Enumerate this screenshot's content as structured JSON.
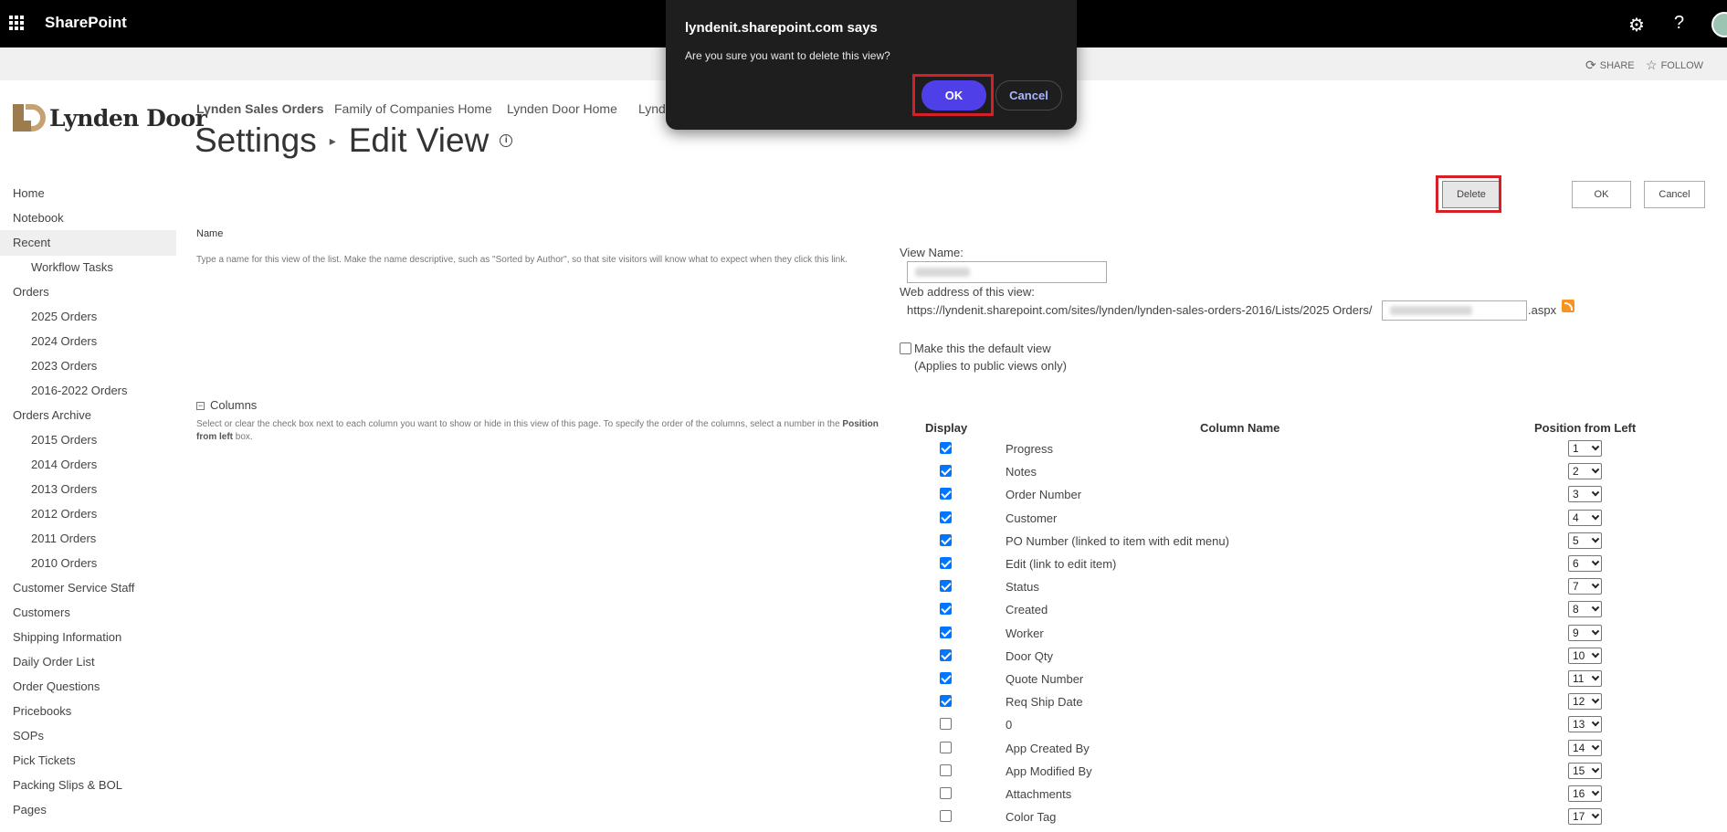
{
  "suitebar": {
    "brand": "SharePoint",
    "gear_icon": "gear-icon",
    "help_label": "?"
  },
  "ribbon": {
    "share": "SHARE",
    "follow": "FOLLOW"
  },
  "logo": {
    "text": "Lynden Door"
  },
  "topnav": [
    "Lynden Sales Orders",
    "Family of Companies Home",
    "Lynden Door Home",
    "Lynde"
  ],
  "title": {
    "section": "Settings",
    "separator": "▸",
    "page": "Edit View",
    "info": "i"
  },
  "leftnav": [
    {
      "label": "Home",
      "sub": false
    },
    {
      "label": "Notebook",
      "sub": false
    },
    {
      "label": "Recent",
      "sub": false
    },
    {
      "label": "Workflow Tasks",
      "sub": true
    },
    {
      "label": "Orders",
      "sub": false
    },
    {
      "label": "2025 Orders",
      "sub": true
    },
    {
      "label": "2024 Orders",
      "sub": true
    },
    {
      "label": "2023 Orders",
      "sub": true
    },
    {
      "label": "2016-2022 Orders",
      "sub": true
    },
    {
      "label": "Orders Archive",
      "sub": false
    },
    {
      "label": "2015 Orders",
      "sub": true
    },
    {
      "label": "2014 Orders",
      "sub": true
    },
    {
      "label": "2013 Orders",
      "sub": true
    },
    {
      "label": "2012 Orders",
      "sub": true
    },
    {
      "label": "2011 Orders",
      "sub": true
    },
    {
      "label": "2010 Orders",
      "sub": true
    },
    {
      "label": "Customer Service Staff",
      "sub": false
    },
    {
      "label": "Customers",
      "sub": false
    },
    {
      "label": "Shipping Information",
      "sub": false
    },
    {
      "label": "Daily Order List",
      "sub": false
    },
    {
      "label": "Order Questions",
      "sub": false
    },
    {
      "label": "Pricebooks",
      "sub": false
    },
    {
      "label": "SOPs",
      "sub": false
    },
    {
      "label": "Pick Tickets",
      "sub": false
    },
    {
      "label": "Packing Slips & BOL",
      "sub": false
    },
    {
      "label": "Pages",
      "sub": false
    }
  ],
  "buttons": {
    "delete": "Delete",
    "ok": "OK",
    "cancel": "Cancel"
  },
  "name_section": {
    "label": "Name",
    "description": "Type a name for this view of the list. Make the name descriptive, such as \"Sorted by Author\", so that site visitors will know what to expect when they click this link.",
    "view_name_label": "View Name:",
    "web_address_label": "Web address of this view:",
    "url_prefix": "https://lyndenit.sharepoint.com/sites/lynden/lynden-sales-orders-2016/Lists/2025 Orders/",
    "url_suffix": ".aspx",
    "default_view_label": "Make this the default view",
    "default_view_note": "(Applies to public views only)"
  },
  "columns_section": {
    "label": "Columns",
    "description_1": "Select or clear the check box next to each column you want to show or hide in this view of this page. To specify the order of the columns, select a number in the",
    "description_bold": "Position from left",
    "description_2": "box.",
    "headers": {
      "display": "Display",
      "name": "Column Name",
      "position": "Position from Left"
    },
    "rows": [
      {
        "name": "Progress",
        "checked": true,
        "position": "1"
      },
      {
        "name": "Notes",
        "checked": true,
        "position": "2"
      },
      {
        "name": "Order Number",
        "checked": true,
        "position": "3"
      },
      {
        "name": "Customer",
        "checked": true,
        "position": "4"
      },
      {
        "name": "PO Number (linked to item with edit menu)",
        "checked": true,
        "position": "5"
      },
      {
        "name": "Edit (link to edit item)",
        "checked": true,
        "position": "6"
      },
      {
        "name": "Status",
        "checked": true,
        "position": "7"
      },
      {
        "name": "Created",
        "checked": true,
        "position": "8"
      },
      {
        "name": "Worker",
        "checked": true,
        "position": "9"
      },
      {
        "name": "Door Qty",
        "checked": true,
        "position": "10"
      },
      {
        "name": "Quote Number",
        "checked": true,
        "position": "11"
      },
      {
        "name": "Req Ship Date",
        "checked": true,
        "position": "12"
      },
      {
        "name": "0",
        "checked": false,
        "position": "13"
      },
      {
        "name": "App Created By",
        "checked": false,
        "position": "14"
      },
      {
        "name": "App Modified By",
        "checked": false,
        "position": "15"
      },
      {
        "name": "Attachments",
        "checked": false,
        "position": "16"
      },
      {
        "name": "Color Tag",
        "checked": false,
        "position": "17"
      }
    ]
  },
  "dialog": {
    "title": "lyndenit.sharepoint.com says",
    "message": "Are you sure you want to delete this view?",
    "ok": "OK",
    "cancel": "Cancel"
  },
  "colors": {
    "suitebar": "#000000",
    "accent": "#4f3fe8",
    "highlight": "#d61f26",
    "checkbox": "#0075ff"
  }
}
